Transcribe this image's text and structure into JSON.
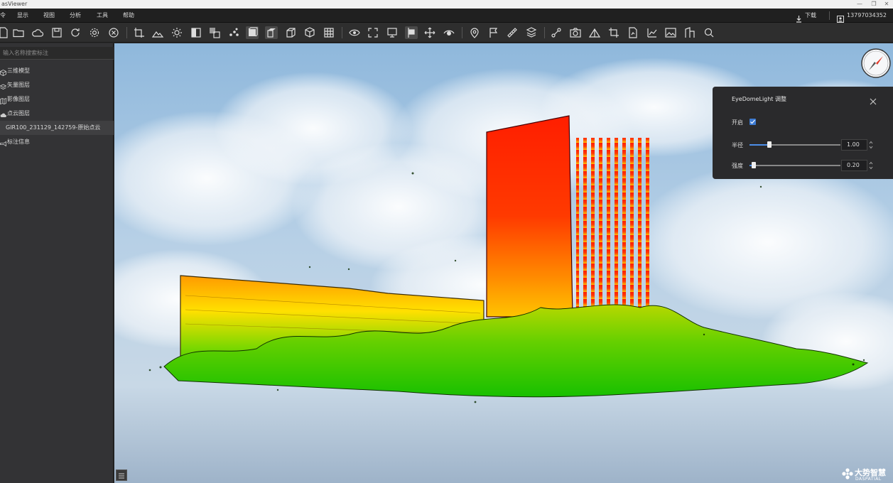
{
  "window": {
    "title": "asViewer",
    "controls": [
      "—",
      "❐",
      "✕"
    ]
  },
  "menubar": {
    "items": [
      "令",
      "显示",
      "视图",
      "分析",
      "工具",
      "帮助"
    ],
    "download_label": "下载",
    "phone": "13797034352"
  },
  "toolbar": {
    "icons": [
      "new-icon",
      "open-folder-icon",
      "cloud-icon",
      "save-icon",
      "refresh-icon",
      "settings-icon",
      "close-circle-icon",
      "crop-icon",
      "landscape-icon",
      "sun-icon",
      "split-view-icon",
      "overlay-icon",
      "point-dots-icon",
      "cube-front-icon",
      "cube-top-icon",
      "cube-side-icon",
      "cube-iso-icon",
      "grid-icon",
      "eye-icon",
      "fit-icon",
      "screen-icon",
      "pin-bar-icon",
      "move-icon",
      "eye-dome-icon",
      "location-icon",
      "flag-polyline-icon",
      "ruler-icon",
      "layers-cube-icon",
      "path-icon",
      "camera-icon",
      "volume-icon",
      "crop-corner-icon",
      "profile-doc-icon",
      "chart-trend-icon",
      "image-icon",
      "building-icon",
      "search-icon"
    ],
    "active": [
      "cube-front-icon",
      "cube-top-icon",
      "pin-bar-icon"
    ]
  },
  "sidebar": {
    "search_placeholder": "输入名称搜索标注",
    "items": [
      {
        "label": "三维模型",
        "icon": "cube-outline-icon"
      },
      {
        "label": "矢量图层",
        "icon": "vector-layer-icon"
      },
      {
        "label": "影像图层",
        "icon": "image-layer-icon"
      },
      {
        "label": "点云图层",
        "icon": "cloud-layer-icon"
      },
      {
        "label": "GIR100_231129_142759-原始点云",
        "icon": ""
      },
      {
        "label": "标注信息",
        "icon": "annotation-icon"
      }
    ]
  },
  "panel": {
    "title": "EyeDomeLight 调整",
    "enable_label": "开启",
    "enabled": true,
    "radius": {
      "label": "半径",
      "value": "1.00",
      "fraction": 0.22
    },
    "strength": {
      "label": "强度",
      "value": "0.20",
      "fraction": 0.05
    }
  },
  "logo": {
    "text": "大势智慧",
    "sub": "DASPATIAL"
  },
  "colors": {
    "accent": "#3d7bd3",
    "cloud_top": "#ff2a00",
    "cloud_mid": "#ffcc00",
    "cloud_bottom": "#22cc00",
    "sky": "#9fc3e0"
  }
}
